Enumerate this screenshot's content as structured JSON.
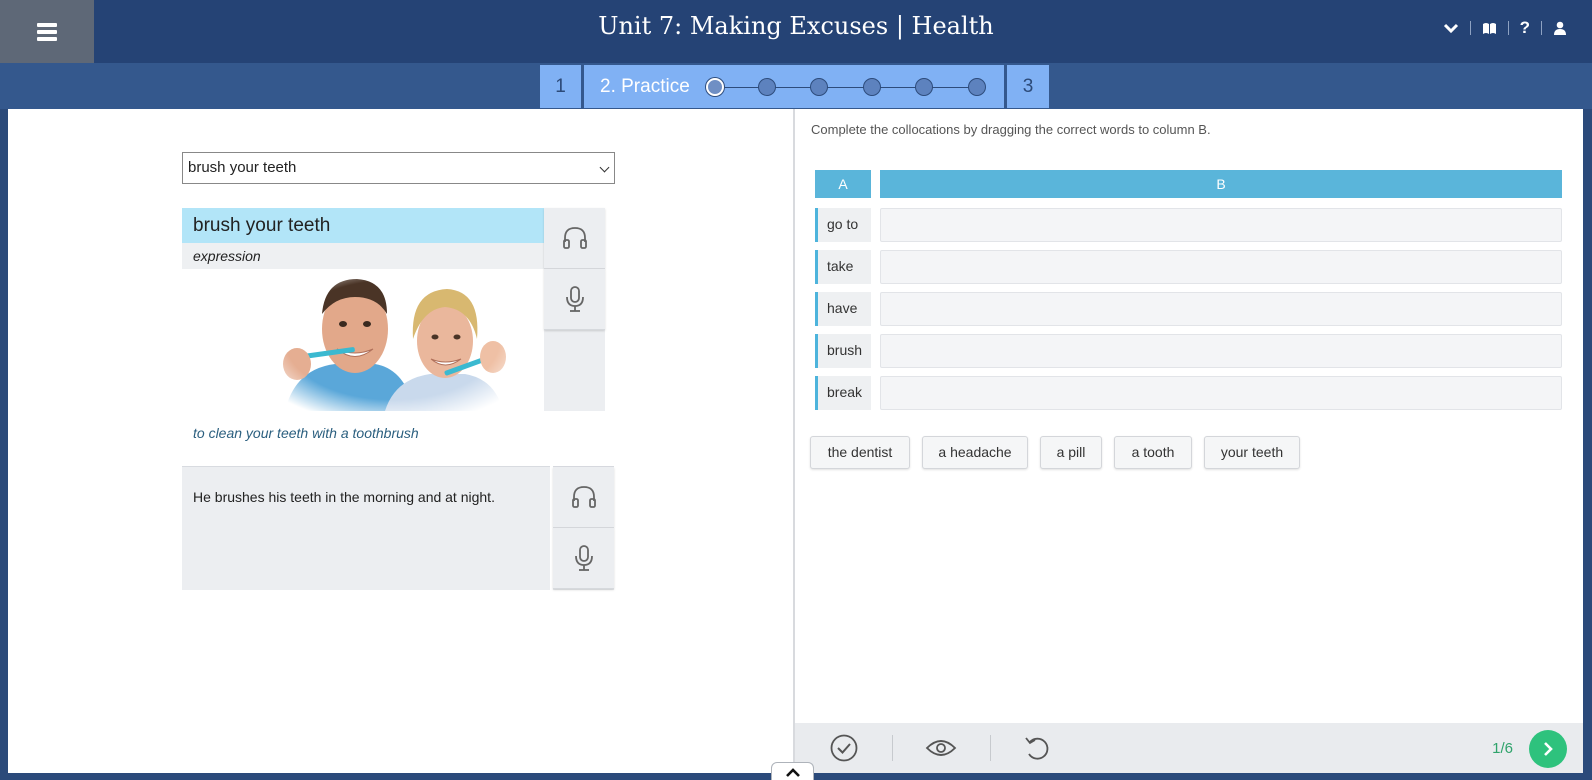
{
  "header": {
    "title": "Unit 7: Making Excuses | Health",
    "menu_icon": "hamburger-icon",
    "icons": [
      "chevron-down-icon",
      "book-icon",
      "help-icon",
      "user-icon"
    ],
    "help_glyph": "?"
  },
  "steps": {
    "step1": "1",
    "step2": "2. Practice",
    "step3": "3",
    "dots_total": 6,
    "active_dot": 1
  },
  "vocab": {
    "selected": "brush your teeth",
    "word": "brush your teeth",
    "part_of_speech": "expression",
    "definition": "to clean your teeth with a toothbrush",
    "example": "He brushes his teeth in the morning and at night."
  },
  "exercise": {
    "instruction": "Complete the collocations by dragging the correct words to column B.",
    "col_a": "A",
    "col_b": "B",
    "rows": [
      "go to",
      "take",
      "have",
      "brush",
      "break"
    ],
    "chips": [
      "the dentist",
      "a headache",
      "a pill",
      "a tooth",
      "your teeth"
    ]
  },
  "toolbar": {
    "pager": "1/6"
  },
  "colors": {
    "header_bg": "#254375",
    "accent_blue": "#5ab5da",
    "step_blue": "#80b1f4",
    "next_green": "#2ec27d"
  }
}
